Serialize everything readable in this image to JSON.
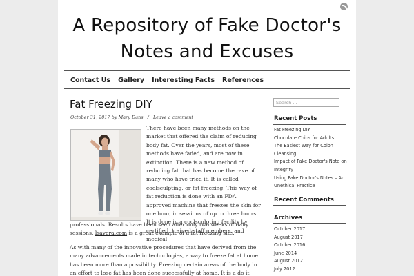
{
  "header": {
    "title_line1": "A Repository of Fake Doctor's",
    "title_line2": "Notes and Excuses"
  },
  "nav": [
    "Contact Us",
    "Gallery",
    "Interesting Facts",
    "References"
  ],
  "post": {
    "title": "Fat Freezing DIY",
    "date": "October 31, 2017",
    "author": "by Mary Dans",
    "comment_link": "Leave a comment",
    "para1": "There have been many methods on the market that offered the claim of reducing body fat. Over the years, most of these methods have faded, and are now in extinction. There is a new method of reducing fat that has become the rave of many who have tried it. It is called coolsculpting, or fat freezing. This way of fat reduction is done with an FDA approved machine that freezes the skin for one hour, in sessions of up to three hours. It is done in a coolsculpting facility by certified, trained staff members, and medical",
    "para1_cont": "professionals. Results have been seen after only two weeks of daily sessions.",
    "link_text": "lsavera.com",
    "para1_end": " is a great example of a fat freezing site.",
    "para2": "As with many of the innovative procedures that have derived from the many advancements made in technologies, a way to freeze fat at home has been more than a possibility. Freezing certain areas of the body in an effort to lose fat has been done successfully at home. It is a do it yourself"
  },
  "sidebar": {
    "search_placeholder": "Search ...",
    "recent_posts_title": "Recent Posts",
    "recent_posts": [
      "Fat Freezing DIY",
      "Chocolate Chips for Adults",
      "The Easiest Way for Colon Cleansing",
      "Impact of Fake Doctor's Note on Integrity",
      "Using Fake Doctor's Notes – An Unethical Practice"
    ],
    "recent_comments_title": "Recent Comments",
    "archives_title": "Archives",
    "archives": [
      "October 2017",
      "August 2017",
      "October 2016",
      "June 2014",
      "August 2012",
      "July 2012"
    ]
  },
  "icons": {
    "feed": "rss-icon"
  },
  "colors": {
    "background": "#ececec",
    "page": "#ffffff",
    "rule": "#555555"
  }
}
